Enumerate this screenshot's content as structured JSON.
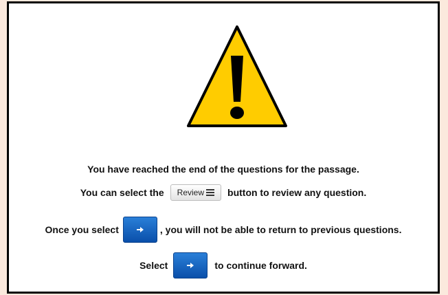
{
  "dialog": {
    "icon": "warning-triangle-icon",
    "line1": "You have reached the end of the questions for the passage.",
    "line2_before": "You can select the",
    "review_button_label": "Review",
    "review_button_icon": "list-icon",
    "line2_after": "button to review any question.",
    "line3_before": "Once you select",
    "next_button_icon": "arrow-right-icon",
    "line3_after": ", you will not be able to return to previous questions.",
    "line4_before": "Select",
    "line4_after": "to continue forward."
  },
  "colors": {
    "warning_fill": "#FFCC00",
    "next_button": "#0B5ED7",
    "page_background": "#FBE9DD"
  }
}
